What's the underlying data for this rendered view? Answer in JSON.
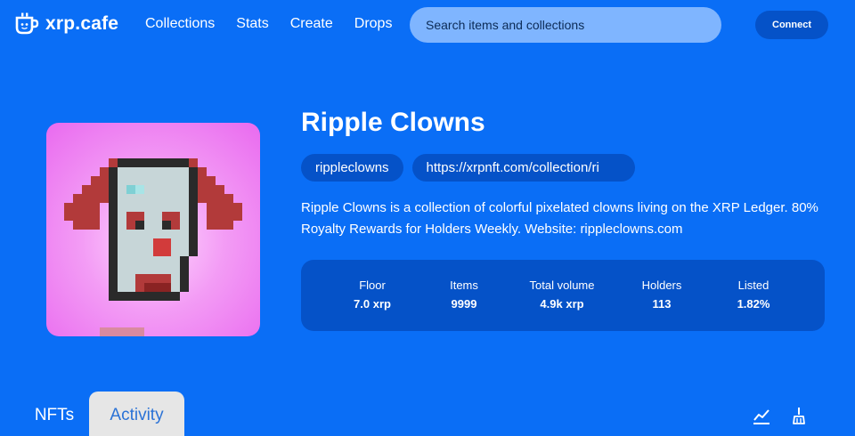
{
  "header": {
    "logo_text": "xrp.cafe",
    "nav": [
      "Collections",
      "Stats",
      "Create",
      "Drops"
    ],
    "search_placeholder": "Search items and collections",
    "connect_label": "Connect"
  },
  "collection": {
    "title": "Ripple Clowns",
    "chips": {
      "handle": "rippleclowns",
      "url": "https://xrpnft.com/collection/ri"
    },
    "description": "Ripple Clowns is a collection of colorful pixelated clowns living on the XRP Ledger. 80% Royalty Rewards for Holders Weekly. Website: rippleclowns.com",
    "stats": [
      {
        "label": "Floor",
        "value": "7.0 xrp"
      },
      {
        "label": "Items",
        "value": "9999"
      },
      {
        "label": "Total volume",
        "value": "4.9k xrp"
      },
      {
        "label": "Holders",
        "value": "113"
      },
      {
        "label": "Listed",
        "value": "1.82%"
      }
    ]
  },
  "tabs": {
    "nfts": "NFTs",
    "activity": "Activity",
    "active": "Activity"
  },
  "icons": {
    "logo": "coffee-cup-icon",
    "chart": "line-chart-icon",
    "sweep": "broom-icon"
  },
  "colors": {
    "background": "#0a6ef6",
    "panel": "#0552c8",
    "search": "#7fb5ff",
    "active_tab": "#e6e6e6"
  }
}
